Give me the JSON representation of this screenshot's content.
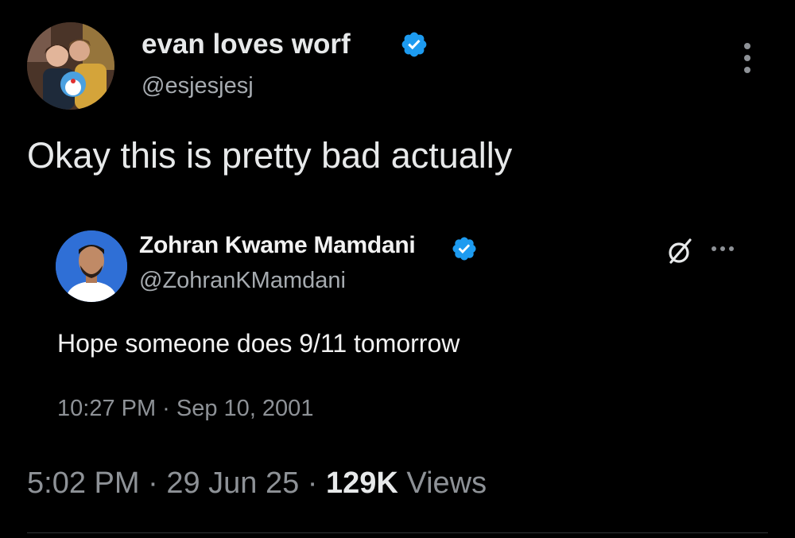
{
  "tweet": {
    "author_name": "evan loves worf",
    "author_handle": "@esjesjesj",
    "text": "Okay this is pretty bad actually",
    "time": "5:02 PM",
    "date": "29 Jun 25",
    "separator": "·",
    "views_count": "129K",
    "views_label": "Views"
  },
  "quoted_tweet": {
    "author_name": "Zohran Kwame Mamdani",
    "author_handle": "@ZohranKMamdani",
    "text": "Hope someone does 9/11 tomorrow",
    "timestamp": "10:27 PM · Sep 10, 2001"
  },
  "icons": {
    "verified": "verified-badge-icon",
    "more": "more-options-icon",
    "grok": "grok-icon"
  },
  "colors": {
    "background": "#000000",
    "verified": "#1d9bf0",
    "text_primary": "#e7e9ea",
    "text_secondary": "#8e9297",
    "quote_avatar_bg": "#2f6fd6"
  }
}
